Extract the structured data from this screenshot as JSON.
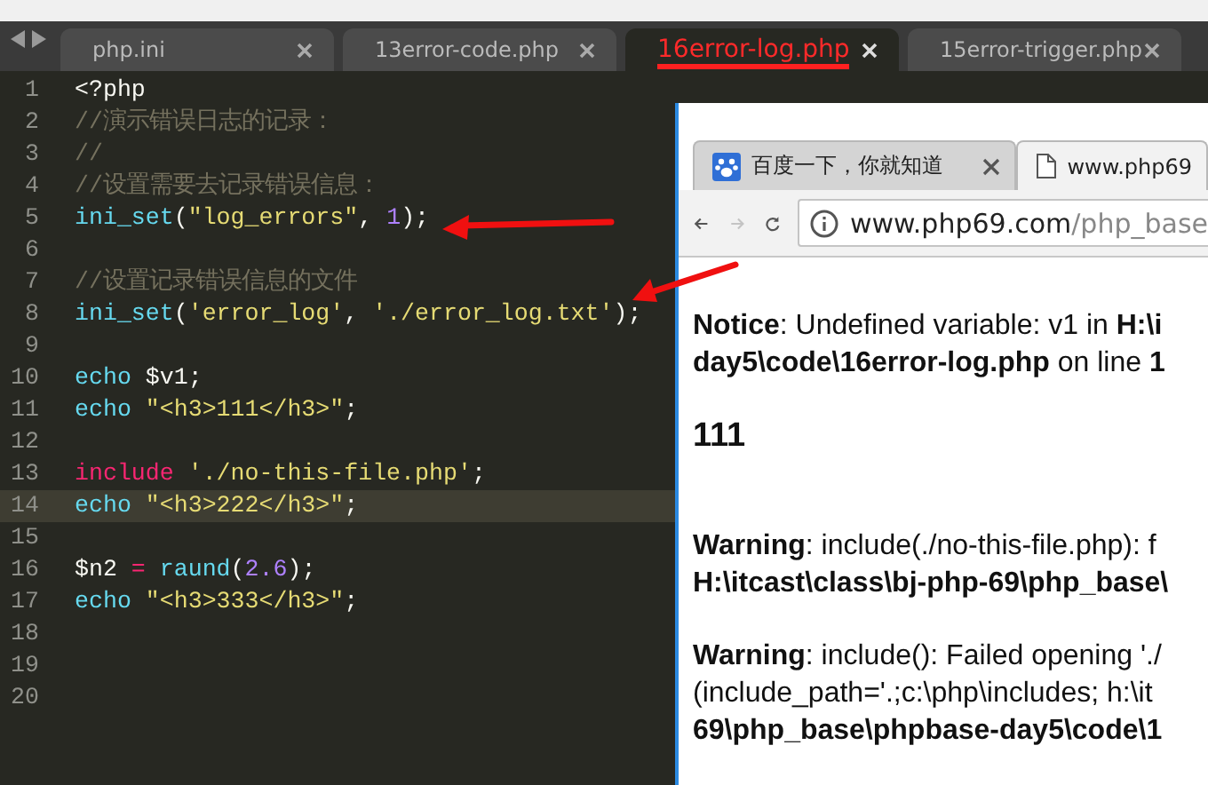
{
  "editor": {
    "tabs": [
      {
        "label": "php.ini",
        "selected": false
      },
      {
        "label": "13error-code.php",
        "selected": false
      },
      {
        "label": "16error-log.php",
        "selected": true
      },
      {
        "label": "15error-trigger.php",
        "selected": false
      }
    ],
    "lines": [
      {
        "number": "1",
        "current": false,
        "tokens": [
          {
            "kind": "text",
            "text": "<?php"
          }
        ]
      },
      {
        "number": "2",
        "current": false,
        "tokens": [
          {
            "kind": "comment",
            "text": "//演示错误日志的记录："
          }
        ]
      },
      {
        "number": "3",
        "current": false,
        "tokens": [
          {
            "kind": "comment",
            "text": "//"
          }
        ]
      },
      {
        "number": "4",
        "current": false,
        "tokens": [
          {
            "kind": "comment",
            "text": "//设置需要去记录错误信息："
          }
        ]
      },
      {
        "number": "5",
        "current": false,
        "tokens": [
          {
            "kind": "function",
            "text": "ini_set"
          },
          {
            "kind": "text",
            "text": "("
          },
          {
            "kind": "string",
            "text": "\"log_errors\""
          },
          {
            "kind": "text",
            "text": ", "
          },
          {
            "kind": "number",
            "text": "1"
          },
          {
            "kind": "text",
            "text": ");"
          }
        ]
      },
      {
        "number": "6",
        "current": false
      },
      {
        "number": "7",
        "current": false,
        "tokens": [
          {
            "kind": "comment",
            "text": "//设置记录错误信息的文件"
          }
        ]
      },
      {
        "number": "8",
        "current": false,
        "tokens": [
          {
            "kind": "function",
            "text": "ini_set"
          },
          {
            "kind": "text",
            "text": "("
          },
          {
            "kind": "string",
            "text": "'error_log'"
          },
          {
            "kind": "text",
            "text": ", "
          },
          {
            "kind": "string",
            "text": "'./error_log.txt'"
          },
          {
            "kind": "text",
            "text": ");"
          }
        ]
      },
      {
        "number": "9",
        "current": false
      },
      {
        "number": "10",
        "current": false,
        "tokens": [
          {
            "kind": "function",
            "text": "echo"
          },
          {
            "kind": "text",
            "text": " $v1;"
          }
        ]
      },
      {
        "number": "11",
        "current": false,
        "tokens": [
          {
            "kind": "function",
            "text": "echo"
          },
          {
            "kind": "string",
            "text": " \"<h3>111</h3>\""
          },
          {
            "kind": "text",
            "text": ";"
          }
        ]
      },
      {
        "number": "12",
        "current": false
      },
      {
        "number": "13",
        "current": false,
        "tokens": [
          {
            "kind": "keyword",
            "text": "include"
          },
          {
            "kind": "string",
            "text": " './no-this-file.php'"
          },
          {
            "kind": "text",
            "text": ";"
          }
        ]
      },
      {
        "number": "14",
        "current": true,
        "tokens": [
          {
            "kind": "function",
            "text": "echo"
          },
          {
            "kind": "string",
            "text": " \"<h3>222</h3>\""
          },
          {
            "kind": "text",
            "text": ";"
          }
        ]
      },
      {
        "number": "15",
        "current": false
      },
      {
        "number": "16",
        "current": false,
        "tokens": [
          {
            "kind": "text",
            "text": "$n2 "
          },
          {
            "kind": "keyword",
            "text": "="
          },
          {
            "kind": "function",
            "text": " raund"
          },
          {
            "kind": "text",
            "text": "("
          },
          {
            "kind": "number",
            "text": "2.6"
          },
          {
            "kind": "text",
            "text": ");"
          }
        ]
      },
      {
        "number": "17",
        "current": false,
        "tokens": [
          {
            "kind": "function",
            "text": "echo"
          },
          {
            "kind": "string",
            "text": " \"<h3>333</h3>\""
          },
          {
            "kind": "text",
            "text": ";"
          }
        ]
      },
      {
        "number": "18",
        "current": false
      },
      {
        "number": "19",
        "current": false
      },
      {
        "number": "20",
        "current": false
      }
    ]
  },
  "browser": {
    "tabs": [
      {
        "label": "百度一下，你就知道",
        "kind": "paw",
        "selected": false
      },
      {
        "label": "www.php69",
        "kind": "page",
        "selected": true
      }
    ],
    "nav": [
      {
        "kind": "back",
        "disabled": false
      },
      {
        "kind": "forward",
        "disabled": true
      },
      {
        "kind": "reload",
        "disabled": false
      }
    ],
    "address": {
      "host": "www.php69.com",
      "path": "/php_base"
    },
    "content": [
      {
        "kind": "paragraph",
        "lines": [
          "**Notice**: Undefined variable: v1 in **H:\\i**",
          "**day5\\code\\16error-log.php** on line **1**"
        ]
      },
      {
        "kind": "heading",
        "lines": [
          "111"
        ]
      },
      {
        "kind": "paragraph",
        "lines": [
          "**Warning**: include(./no-this-file.php): f",
          "**H:\\itcast\\class\\bj-php-69\\php_base\\**"
        ]
      },
      {
        "kind": "paragraph",
        "lines": [
          "**Warning**: include(): Failed opening './",
          "(include_path='.;c:\\php\\includes; h:\\it",
          "**69\\php_base\\phpbase-day5\\code\\1**"
        ]
      }
    ]
  }
}
